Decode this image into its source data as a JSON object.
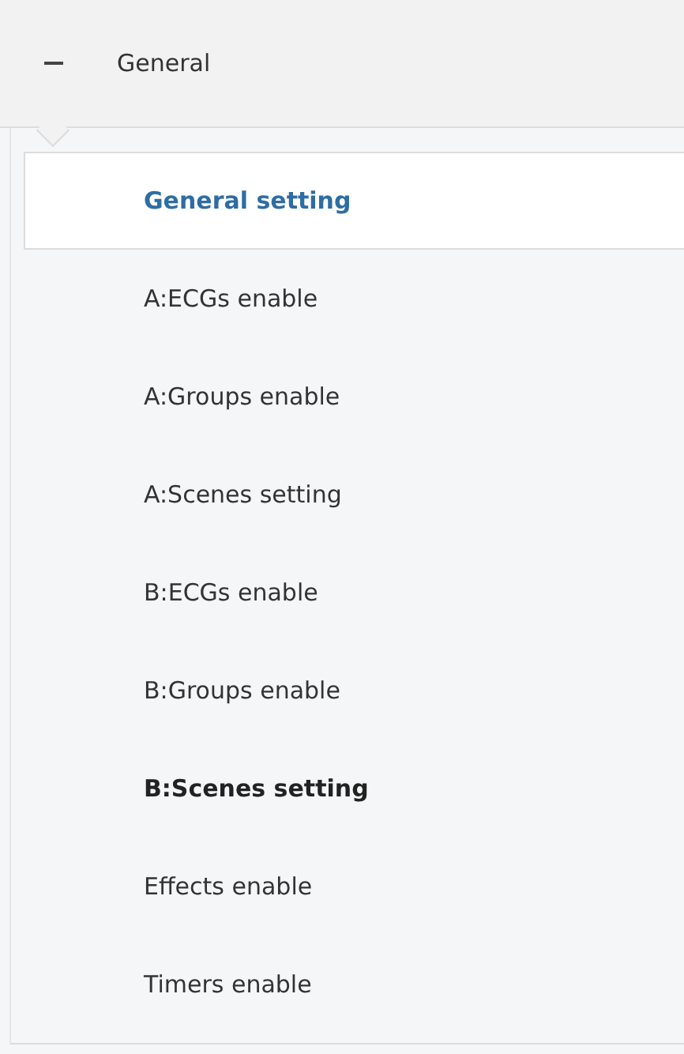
{
  "group": {
    "title": "General",
    "expanded": true
  },
  "items": [
    {
      "label": "General setting",
      "selected": true,
      "emphasized": false
    },
    {
      "label": "A:ECGs enable",
      "selected": false,
      "emphasized": false
    },
    {
      "label": "A:Groups enable",
      "selected": false,
      "emphasized": false
    },
    {
      "label": "A:Scenes setting",
      "selected": false,
      "emphasized": false
    },
    {
      "label": "B:ECGs enable",
      "selected": false,
      "emphasized": false
    },
    {
      "label": "B:Groups enable",
      "selected": false,
      "emphasized": false
    },
    {
      "label": "B:Scenes setting",
      "selected": false,
      "emphasized": true
    },
    {
      "label": "Effects enable",
      "selected": false,
      "emphasized": false
    },
    {
      "label": "Timers enable",
      "selected": false,
      "emphasized": false
    }
  ]
}
